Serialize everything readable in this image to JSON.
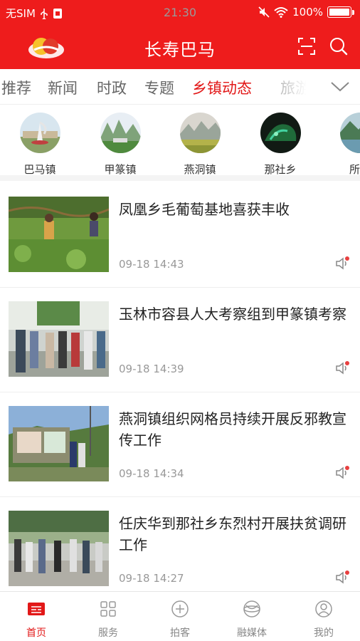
{
  "status_bar": {
    "carrier": "无SIM",
    "time": "21:30",
    "battery": "100%"
  },
  "header": {
    "title": "长寿巴马"
  },
  "tabs": [
    {
      "label": "推荐",
      "active": false
    },
    {
      "label": "新闻",
      "active": false
    },
    {
      "label": "时政",
      "active": false
    },
    {
      "label": "专题",
      "active": false
    },
    {
      "label": "乡镇动态",
      "active": true
    },
    {
      "label": "旅游",
      "active": false
    }
  ],
  "towns": [
    {
      "name": "巴马镇"
    },
    {
      "name": "甲篆镇"
    },
    {
      "name": "燕洞镇"
    },
    {
      "name": "那社乡"
    },
    {
      "name": "所略"
    }
  ],
  "news": [
    {
      "headline": "凤凰乡毛葡萄基地喜获丰收",
      "time": "09-18 14:43"
    },
    {
      "headline": "玉林市容县人大考察组到甲篆镇考察",
      "time": "09-18 14:39"
    },
    {
      "headline": "燕洞镇组织网格员持续开展反邪教宣传工作",
      "time": "09-18 14:34"
    },
    {
      "headline": "任庆华到那社乡东烈村开展扶贫调研工作",
      "time": "09-18 14:27"
    }
  ],
  "bottom_nav": [
    {
      "label": "首页",
      "icon": "home-icon",
      "active": true
    },
    {
      "label": "服务",
      "icon": "grid-icon",
      "active": false
    },
    {
      "label": "拍客",
      "icon": "plus-circle-icon",
      "active": false
    },
    {
      "label": "融媒体",
      "icon": "globe-icon",
      "active": false
    },
    {
      "label": "我的",
      "icon": "user-icon",
      "active": false
    }
  ],
  "colors": {
    "brand": "#ee1c1c",
    "active_text": "#e21818",
    "muted_text": "#999999"
  }
}
